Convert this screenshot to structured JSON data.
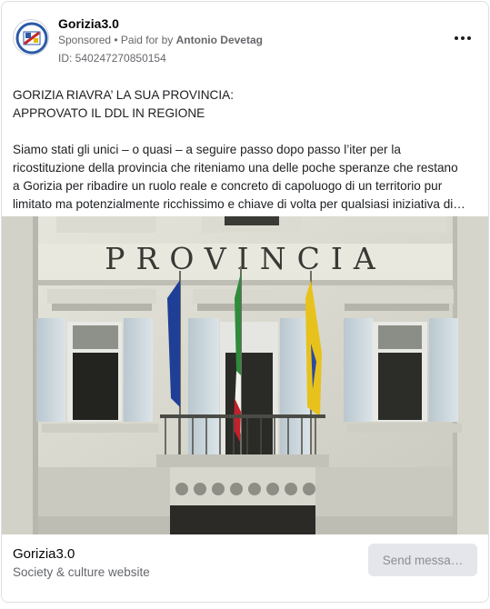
{
  "header": {
    "page_name": "Gorizia3.0",
    "sponsored_label": "Sponsored",
    "separator": " • ",
    "paid_for_label": "Paid for by ",
    "payer": "Antonio Devetag",
    "ad_id": "ID: 540247270850154",
    "avatar_icon": "gorizia-logo-icon",
    "more_icon": "more-options-icon"
  },
  "post": {
    "headline_lines": [
      "GORIZIA RIAVRA’ LA SUA PROVINCIA:",
      "APPROVATO IL DDL IN REGIONE"
    ],
    "body_lines": [
      "Siamo stati gli unici – o quasi – a seguire passo dopo passo l’iter per la",
      "ricostituzione della provincia che riteniamo una delle poche speranze che restano",
      "a Gorizia per ribadire un ruolo reale e concreto di capoluogo di un territorio pur",
      "limitato ma potenzialmente ricchissimo e chiave di volta per qualsiasi iniziativa di…"
    ]
  },
  "photo": {
    "facade_inscription": "PROVINCIA"
  },
  "footer": {
    "page_name": "Gorizia3.0",
    "category": "Society & culture website",
    "cta_label": "Send messa…"
  }
}
